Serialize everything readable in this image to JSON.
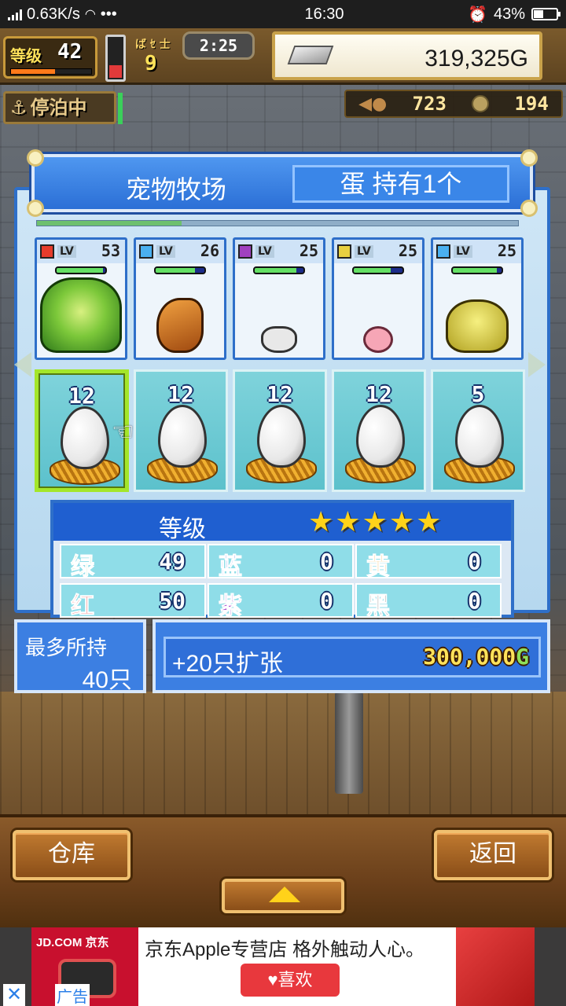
{
  "status_bar": {
    "network_type": "4G",
    "speed": "0.63K/s",
    "more": "•••",
    "time": "16:30",
    "battery": "43%"
  },
  "hud": {
    "level_label": "等级",
    "level_value": "42",
    "crest_label": "ば ｾ 士",
    "crest_value": "9",
    "timer": "2:25",
    "money": "319,325G",
    "moored_label": "停泊中",
    "resource_wood": "723",
    "resource_medals": "194"
  },
  "dialog": {
    "title": "宠物牧场",
    "egg_count": "蛋 持有1个"
  },
  "pets": [
    {
      "lv_label": "LV",
      "level": "53",
      "element_color": "#e63c2c",
      "hp_fraction": 0.95,
      "art": "green-dragon"
    },
    {
      "lv_label": "LV",
      "level": "26",
      "element_color": "#4ab0f0",
      "hp_fraction": 0.8,
      "art": "hermit-crab"
    },
    {
      "lv_label": "LV",
      "level": "25",
      "element_color": "#a040c0",
      "hp_fraction": 0.85,
      "art": "white-cat"
    },
    {
      "lv_label": "LV",
      "level": "25",
      "element_color": "#e8d040",
      "hp_fraction": 0.75,
      "art": "pink-bunny"
    },
    {
      "lv_label": "LV",
      "level": "25",
      "element_color": "#4ab0f0",
      "hp_fraction": 0.9,
      "art": "yellow-crab"
    }
  ],
  "eggs": [
    {
      "timer": "12",
      "selected": true
    },
    {
      "timer": "12",
      "selected": false
    },
    {
      "timer": "12",
      "selected": false
    },
    {
      "timer": "12",
      "selected": false
    },
    {
      "timer": "5",
      "selected": false
    }
  ],
  "stats": {
    "title": "等级",
    "stars": "★★★★★",
    "star_count": 5,
    "cells": [
      {
        "label": "绿",
        "value": "49",
        "color": "#3ad05a"
      },
      {
        "label": "蓝",
        "value": "0",
        "color": "#2a4ad8"
      },
      {
        "label": "黄",
        "value": "0",
        "color": "#e8a020"
      },
      {
        "label": "红",
        "value": "50",
        "color": "#e83a3a"
      },
      {
        "label": "紫",
        "value": "0",
        "color": "#9a30c8"
      },
      {
        "label": "黑",
        "value": "0",
        "color": "#222222"
      }
    ]
  },
  "capacity": {
    "label": "最多所持",
    "value": "40只"
  },
  "expand": {
    "label": "+20只扩张",
    "price": "300,000",
    "currency": "G"
  },
  "buttons": {
    "warehouse": "仓库",
    "back": "返回"
  },
  "ad": {
    "logo": "JD.COM 京东",
    "headline": "京东Apple专营店 格外触动人心。",
    "like": "♥喜欢",
    "close": "✕",
    "tag": "广告"
  }
}
